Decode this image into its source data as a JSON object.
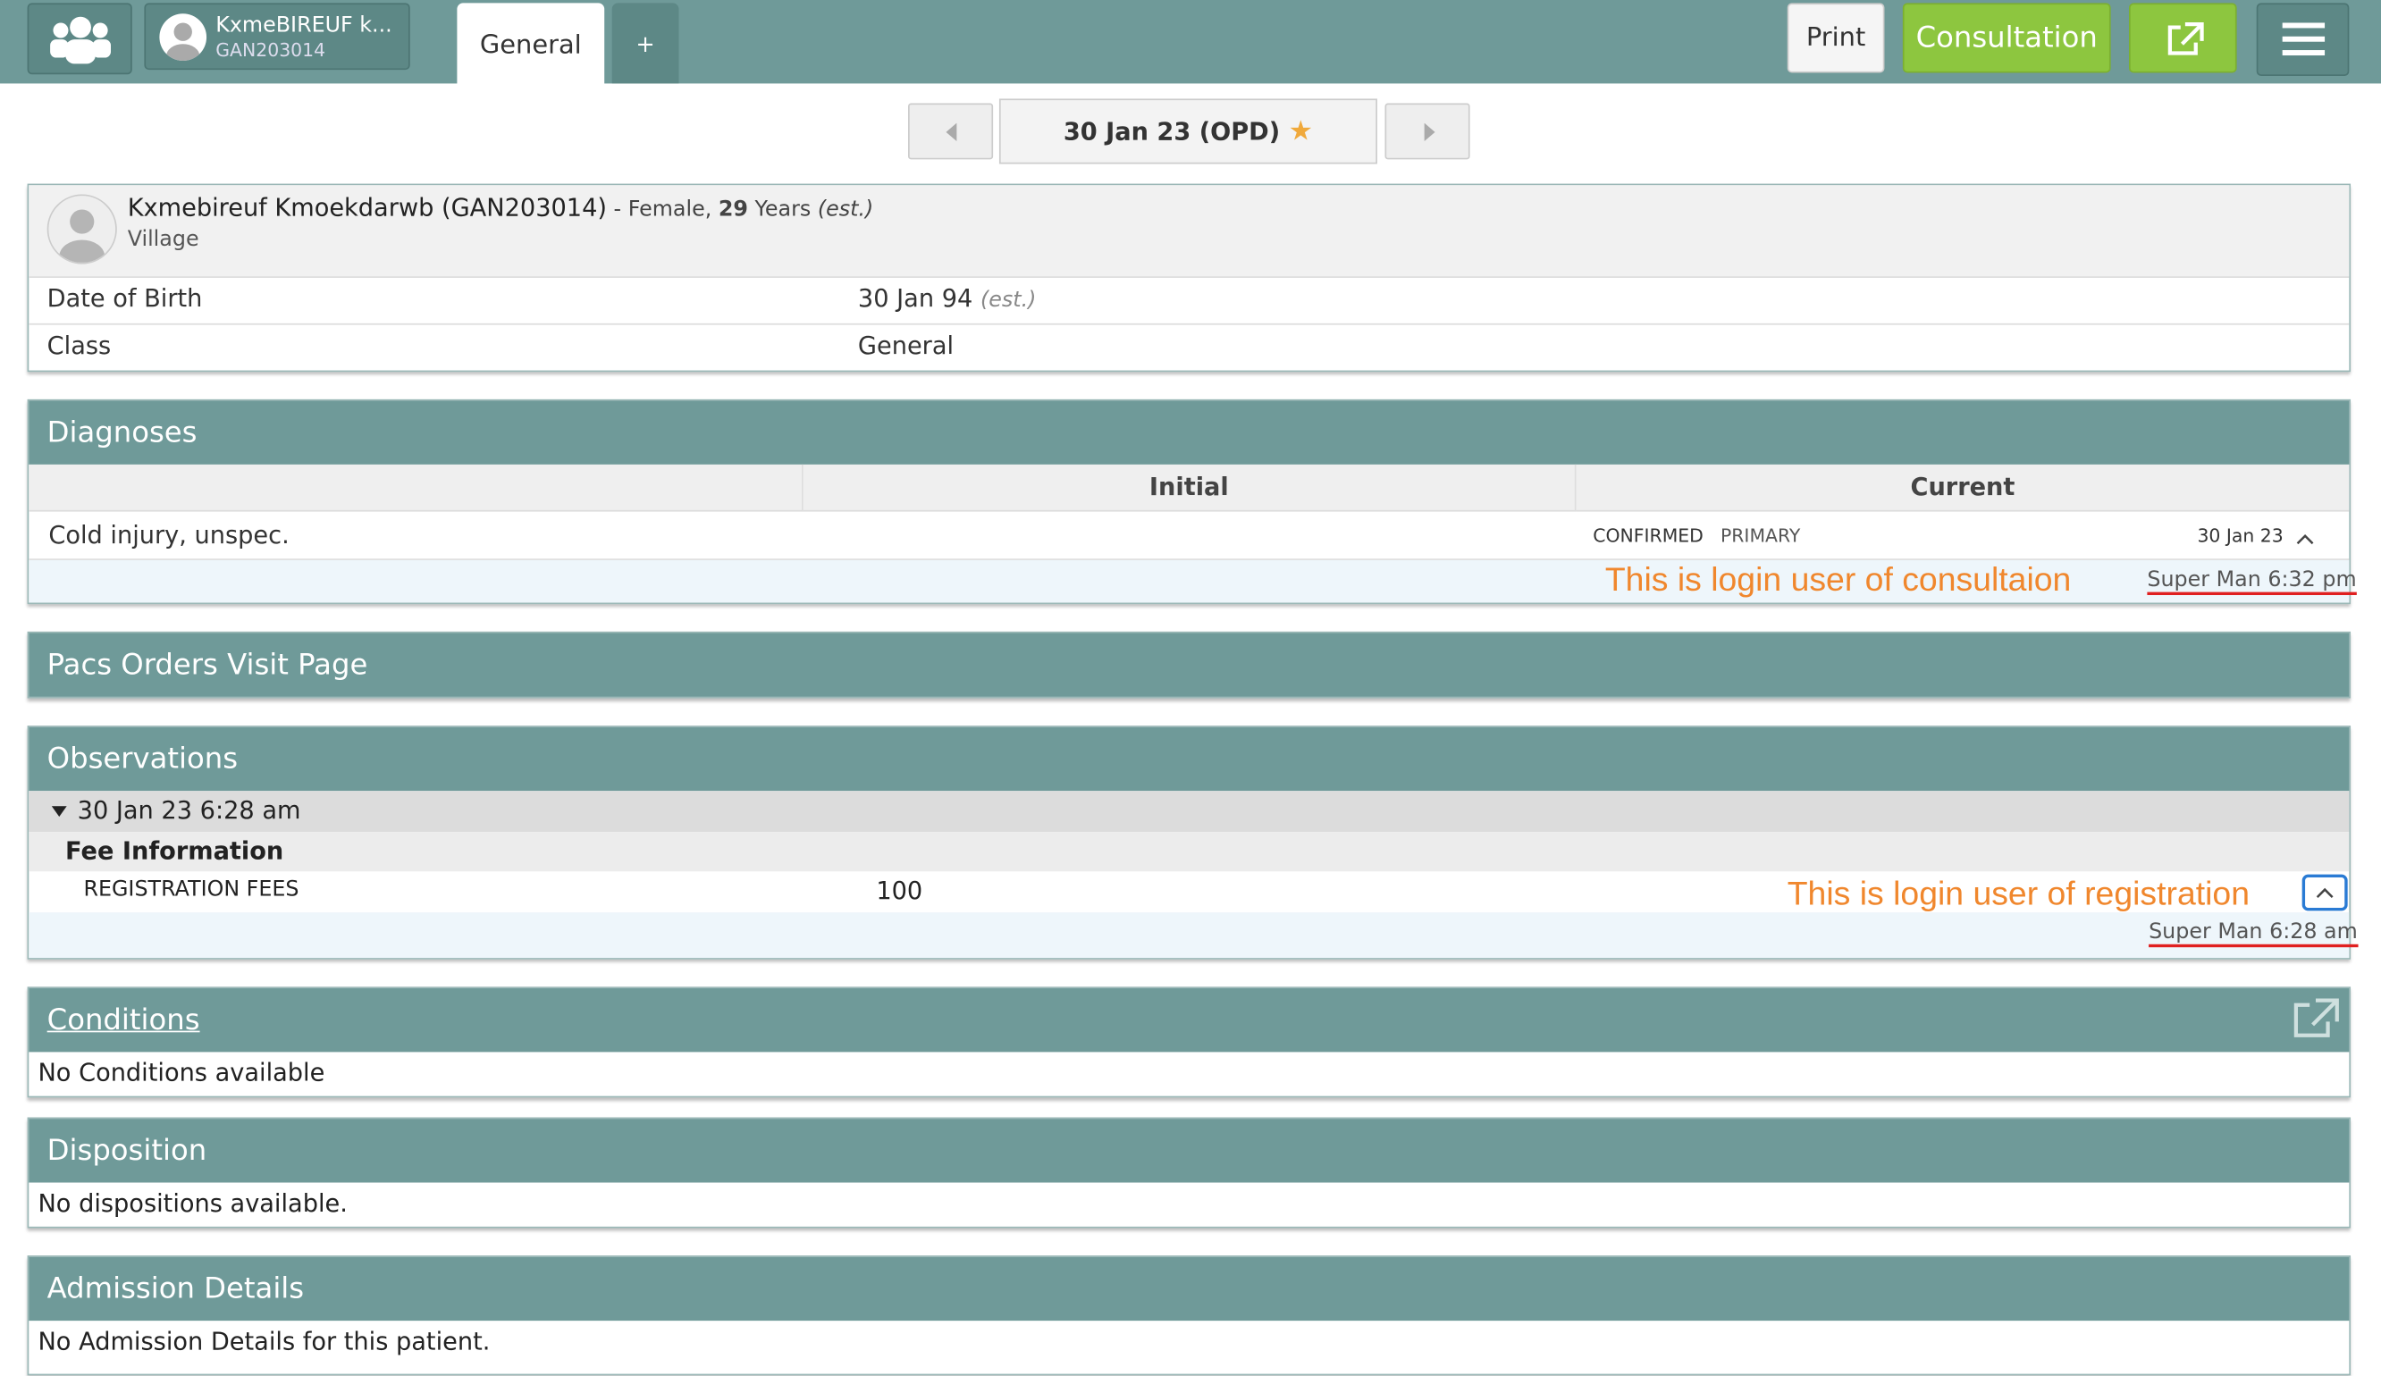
{
  "header": {
    "patient_name": "KxmeBIREUF k...",
    "patient_id": "GAN203014",
    "tabs": [
      {
        "label": "General"
      },
      {
        "label": "+"
      }
    ],
    "print_label": "Print",
    "consultation_label": "Consultation"
  },
  "visit_nav": {
    "date_label": "30 Jan 23 (OPD)"
  },
  "patient": {
    "name": "Kxmebireuf Kmoekdarwb (GAN203014)",
    "sep": " - Female, ",
    "age": "29",
    "age_unit": " Years ",
    "age_est": "(est.)",
    "village": "Village",
    "dob_label": "Date of Birth",
    "dob_value": "30 Jan 94",
    "dob_est": "(est.)",
    "class_label": "Class",
    "class_value": "General"
  },
  "diagnoses": {
    "title": "Diagnoses",
    "col_initial": "Initial",
    "col_current": "Current",
    "row_name": "Cold injury, unspec.",
    "status": "CONFIRMED",
    "order": "PRIMARY",
    "date": "30 Jan 23",
    "annotation": "This is login user of consultaion",
    "user": "Super Man 6:32 pm"
  },
  "pacs": {
    "title": "Pacs Orders Visit Page"
  },
  "observations": {
    "title": "Observations",
    "group_date": "30 Jan 23 6:28 am",
    "section": "Fee Information",
    "item_label": "REGISTRATION FEES",
    "item_value": "100",
    "annotation": "This is login user of registration",
    "user": "Super Man 6:28 am"
  },
  "conditions": {
    "title": "Conditions",
    "empty": "No Conditions available"
  },
  "disposition": {
    "title": "Disposition",
    "empty": "No dispositions available."
  },
  "admission": {
    "title": "Admission Details",
    "empty": "No Admission Details for this patient."
  },
  "colors": {
    "header_teal": "#6f9a99",
    "accent_green": "#8dc63f",
    "annotation_orange": "#f0872d",
    "underline_red": "#e02020"
  }
}
